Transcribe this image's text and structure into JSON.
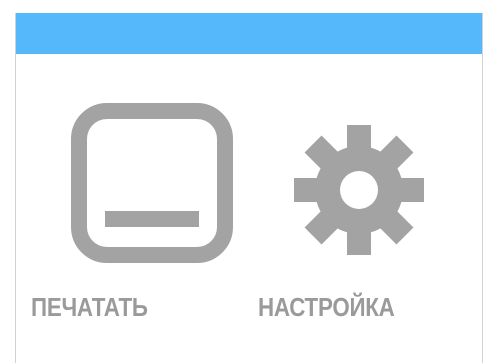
{
  "colors": {
    "header": "#55b8fb",
    "icon": "#a3a3a3",
    "label": "#9a9a9a",
    "background": "#ffffff"
  },
  "menu": {
    "print": {
      "label": "ПЕЧАТАТЬ",
      "icon": "print-icon"
    },
    "settings": {
      "label": "НАСТРОЙКА",
      "icon": "gear-icon"
    }
  }
}
